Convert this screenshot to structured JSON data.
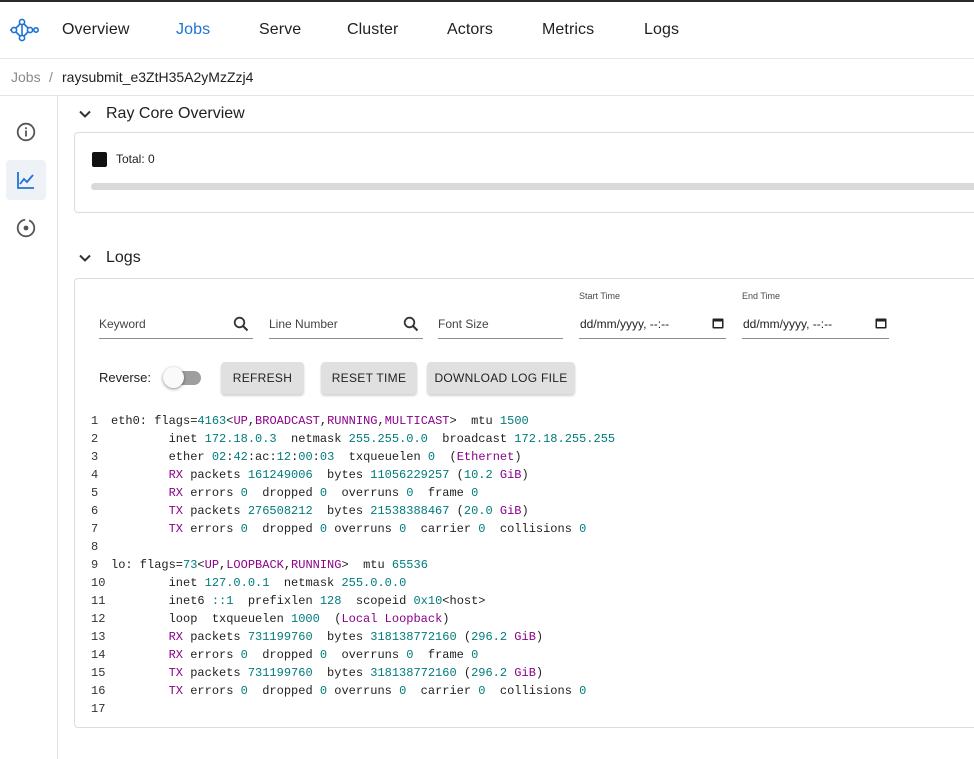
{
  "nav": {
    "items": [
      {
        "label": "Overview",
        "active": false
      },
      {
        "label": "Jobs",
        "active": true
      },
      {
        "label": "Serve",
        "active": false
      },
      {
        "label": "Cluster",
        "active": false
      },
      {
        "label": "Actors",
        "active": false
      },
      {
        "label": "Metrics",
        "active": false
      },
      {
        "label": "Logs",
        "active": false
      }
    ]
  },
  "breadcrumb": {
    "root": "Jobs",
    "separator": "/",
    "current": "raysubmit_e3ZtH35A2yMzZzj4"
  },
  "sidebar": {
    "icons": [
      "info-icon",
      "chart-line-icon",
      "target-icon"
    ],
    "active_index": 1
  },
  "ray_core": {
    "title": "Ray Core Overview",
    "legend_label": "Total: 0",
    "progress": 0
  },
  "logs": {
    "title": "Logs",
    "keyword_placeholder": "Keyword",
    "line_number_placeholder": "Line Number",
    "font_size_placeholder": "Font Size",
    "start_time_label": "Start Time",
    "start_time_value": "dd/mm/yyyy, --:--",
    "end_time_label": "End Time",
    "end_time_value": "dd/mm/yyyy, --:--",
    "reverse_label": "Reverse:",
    "reverse_on": false,
    "refresh_label": "REFRESH",
    "reset_time_label": "RESET TIME",
    "download_label": "DOWNLOAD LOG FILE",
    "lines": [
      "eth0: flags=4163<UP,BROADCAST,RUNNING,MULTICAST>  mtu 1500",
      "        inet 172.18.0.3  netmask 255.255.0.0  broadcast 172.18.255.255",
      "        ether 02:42:ac:12:00:03  txqueuelen 0  (Ethernet)",
      "        RX packets 161249006  bytes 11056229257 (10.2 GiB)",
      "        RX errors 0  dropped 0  overruns 0  frame 0",
      "        TX packets 276508212  bytes 21538388467 (20.0 GiB)",
      "        TX errors 0  dropped 0 overruns 0  carrier 0  collisions 0",
      "",
      "lo: flags=73<UP,LOOPBACK,RUNNING>  mtu 65536",
      "        inet 127.0.0.1  netmask 255.0.0.0",
      "        inet6 ::1  prefixlen 128  scopeid 0x10<host>",
      "        loop  txqueuelen 1000  (Local Loopback)",
      "        RX packets 731199760  bytes 318138772160 (296.2 GiB)",
      "        RX errors 0  dropped 0  overruns 0  frame 0",
      "        TX packets 731199760  bytes 318138772160 (296.2 GiB)",
      "        TX errors 0  dropped 0 overruns 0  carrier 0  collisions 0",
      ""
    ]
  },
  "colors": {
    "accent": "#1e74d6",
    "keyword": "#8b008b",
    "number": "#007b7b"
  }
}
